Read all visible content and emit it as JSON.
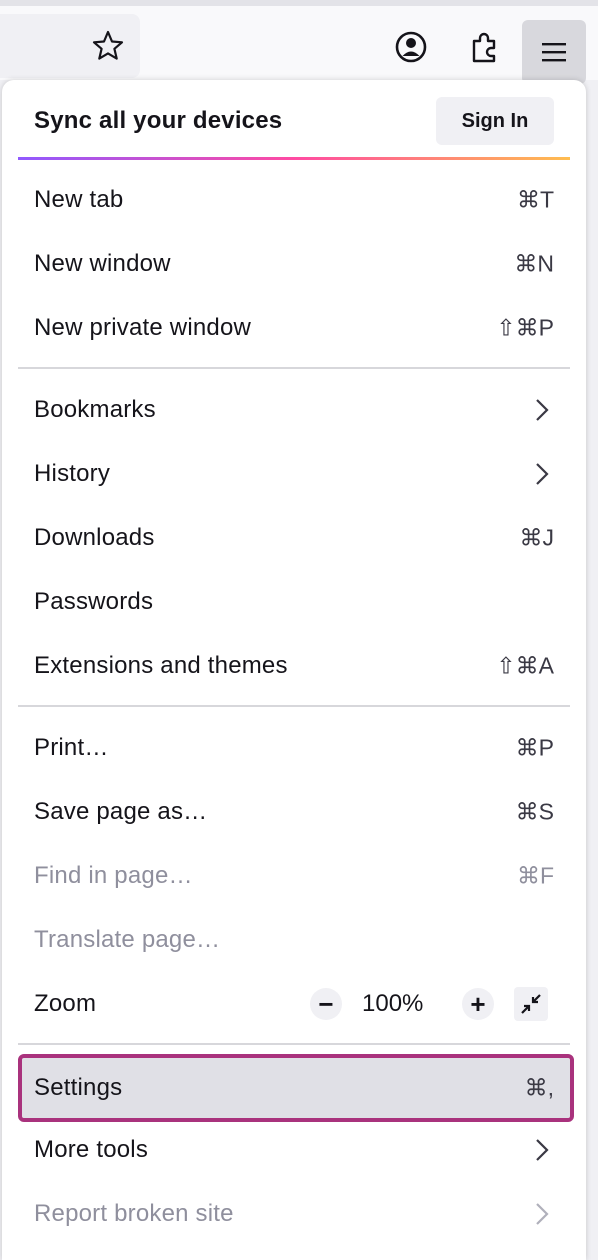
{
  "toolbar": {
    "icons": [
      "star-icon",
      "account-icon",
      "extensions-icon",
      "hamburger-menu-icon"
    ]
  },
  "sync": {
    "title": "Sync all your devices",
    "sign_in_label": "Sign In"
  },
  "menu": {
    "new_tab": {
      "label": "New tab",
      "shortcut": "⌘T"
    },
    "new_window": {
      "label": "New window",
      "shortcut": "⌘N"
    },
    "new_private_window": {
      "label": "New private window",
      "shortcut": "⇧⌘P"
    },
    "bookmarks": {
      "label": "Bookmarks"
    },
    "history": {
      "label": "History"
    },
    "downloads": {
      "label": "Downloads",
      "shortcut": "⌘J"
    },
    "passwords": {
      "label": "Passwords"
    },
    "extensions": {
      "label": "Extensions and themes",
      "shortcut": "⇧⌘A"
    },
    "print": {
      "label": "Print…",
      "shortcut": "⌘P"
    },
    "save_page": {
      "label": "Save page as…",
      "shortcut": "⌘S"
    },
    "find_in_page": {
      "label": "Find in page…",
      "shortcut": "⌘F"
    },
    "translate_page": {
      "label": "Translate page…"
    },
    "zoom": {
      "label": "Zoom",
      "minus": "−",
      "value": "100%",
      "plus": "+"
    },
    "settings": {
      "label": "Settings",
      "shortcut": "⌘,"
    },
    "more_tools": {
      "label": "More tools"
    },
    "report_broken_site": {
      "label": "Report broken site"
    }
  },
  "colors": {
    "highlight_outline": "#a9327d",
    "highlight_bg": "#e0e0e6",
    "disabled_text": "#8f8f9d"
  }
}
